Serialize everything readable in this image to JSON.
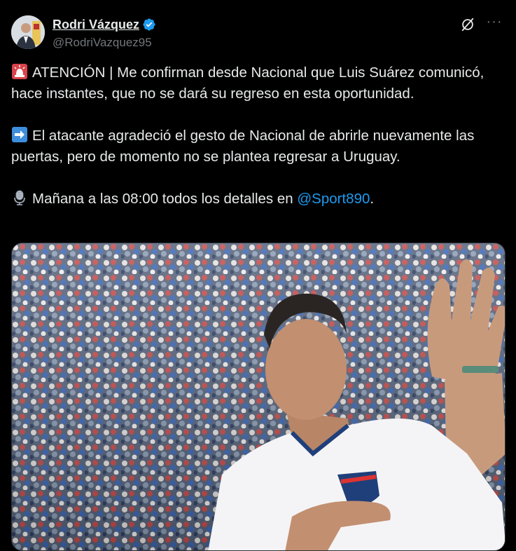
{
  "author": {
    "display_name": "Rodri Vázquez",
    "handle": "@RodriVazquez95",
    "verified": true
  },
  "icons": [
    "siren-icon",
    "arrow-right-icon",
    "microphone-icon",
    "grok-icon",
    "more-icon",
    "verified-badge-icon"
  ],
  "tweet": {
    "line1": "ATENCIÓN | Me confirman desde Nacional que Luis Suárez comunicó, hace instantes, que no se dará su regreso en esta oportunidad.",
    "line2": "El atacante agradeció el gesto de Nacional de abrirle nuevamente las puertas, pero de momento no se plantea regresar a Uruguay.",
    "line3_prefix": "Mañana a las 08:00 todos los detalles en ",
    "mention": "@Sport890",
    "line3_suffix": "."
  },
  "colors": {
    "background": "#000000",
    "text": "#e7e9ea",
    "muted": "#71767b",
    "link": "#1d9bf0",
    "verified": "#1d9bf0"
  }
}
